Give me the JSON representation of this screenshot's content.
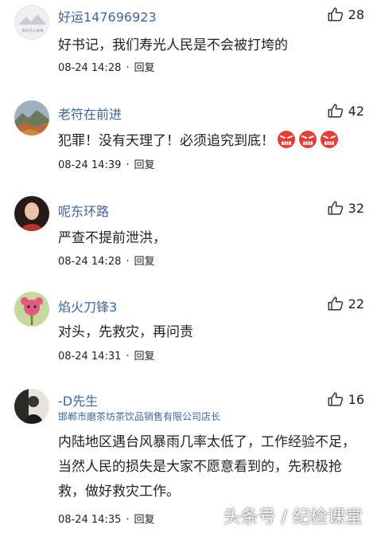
{
  "comments": [
    {
      "username": "好运147696923",
      "subtitle": "",
      "likes": "28",
      "text": "好书记，我们寿光人民是不会被打垮的",
      "time": "08-24 14:28",
      "reply": "回复",
      "avatar_text": "每日点人故事"
    },
    {
      "username": "老符在前进",
      "subtitle": "",
      "likes": "42",
      "text": "犯罪！没有天理了！必须追究到底！",
      "time": "08-24 14:39",
      "reply": "回复",
      "emojis": [
        "angry-face-icon",
        "angry-face-icon",
        "angry-face-icon"
      ]
    },
    {
      "username": "呢东环路",
      "subtitle": "",
      "likes": "32",
      "text": "严查不提前泄洪，",
      "time": "08-24 14:28",
      "reply": "回复"
    },
    {
      "username": "焰火刀锋3",
      "subtitle": "",
      "likes": "22",
      "text": "对头，先救灾，再问责",
      "time": "08-24 14:31",
      "reply": "回复"
    },
    {
      "username": "-D先生",
      "subtitle": "邯郸市磨茶坊茶饮品销售有限公司店长",
      "likes": "16",
      "text": "内陆地区遇台风暴雨几率太低了，工作经验不足，当然人民的损失是大家不愿意看到的，先积极抢救，做好救灾工作。",
      "time": "08-24 14:35",
      "reply": "回复"
    }
  ],
  "watermark": "头条号 / 纪检课堂",
  "colors": {
    "username": "#406599",
    "text": "#222222",
    "background": "#ffffff",
    "emoji_red": "#e0403a"
  }
}
